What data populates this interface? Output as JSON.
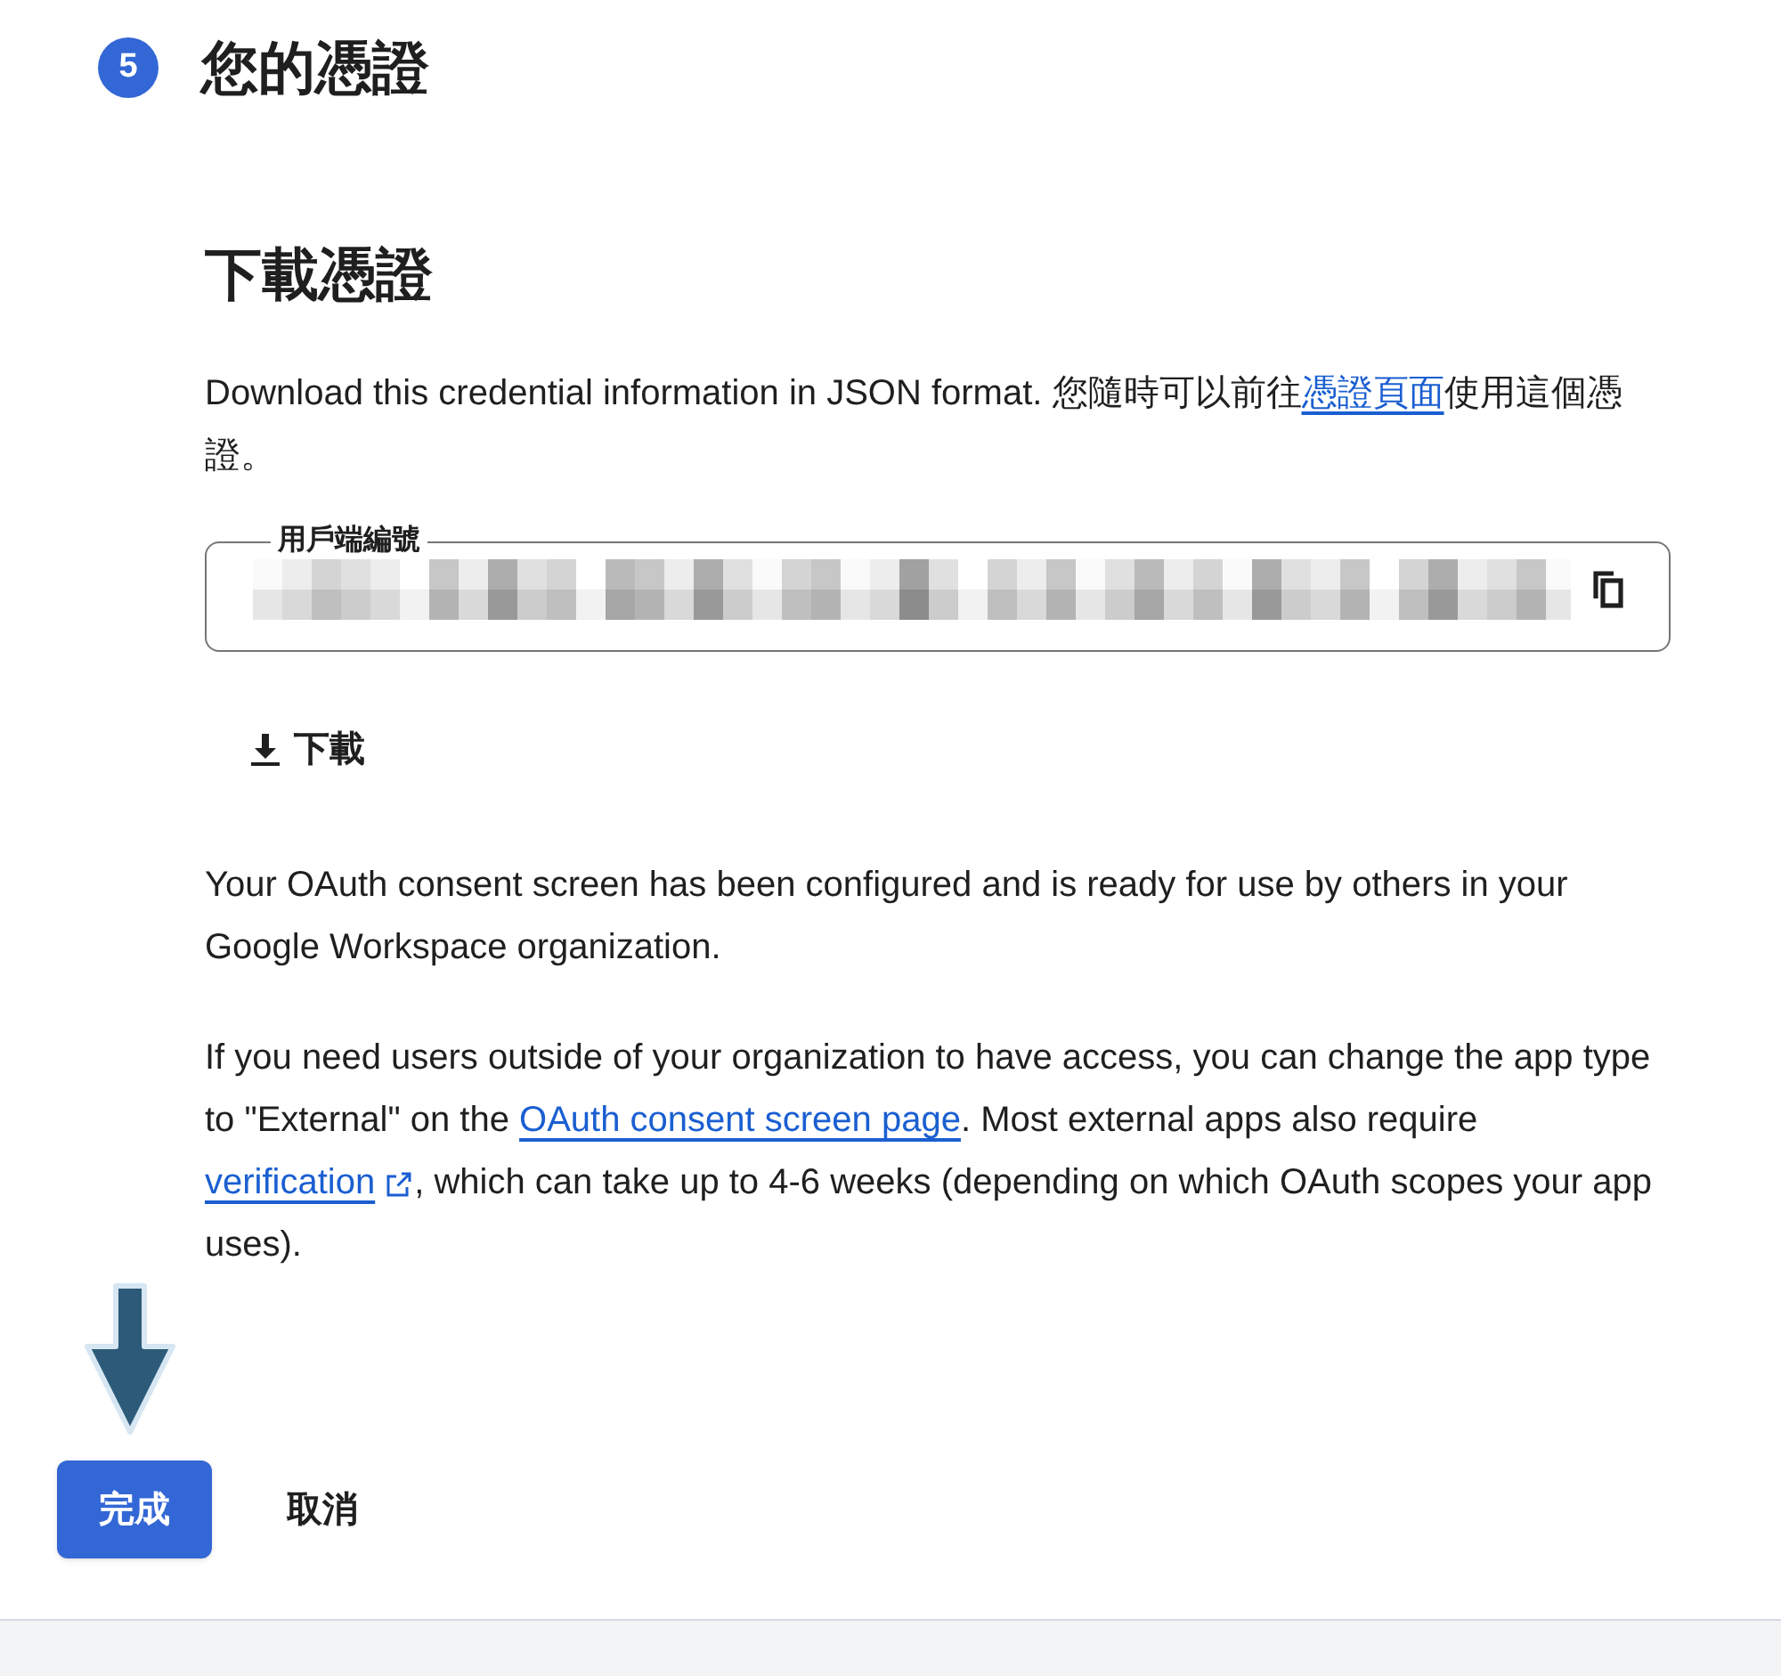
{
  "step": {
    "number": "5",
    "title": "您的憑證"
  },
  "section_title": "下載憑證",
  "intro": [
    {
      "kind": "text",
      "text": "Download this credential information in JSON format. 您隨時可以前往"
    },
    {
      "kind": "link",
      "text": "憑證頁面"
    },
    {
      "kind": "text",
      "text": "使用這個憑證。"
    }
  ],
  "client_id_field": {
    "label": "用戶端編號"
  },
  "download_button": "下載",
  "paragraphs": [
    [
      {
        "kind": "text",
        "text": "Your OAuth consent screen has been configured and is ready for use by others in your Google Workspace organization."
      }
    ],
    [
      {
        "kind": "text",
        "text": "If you need users outside of your organization to have access, you can change the app type to \"External\" on the "
      },
      {
        "kind": "link",
        "text": "OAuth consent screen page"
      },
      {
        "kind": "text",
        "text": ". Most external apps also require "
      },
      {
        "kind": "external_link",
        "text": "verification"
      },
      {
        "kind": "text",
        "text": ", which can take up to 4-6 weeks (depending on which OAuth scopes your app uses)."
      }
    ]
  ],
  "buttons": [
    {
      "kind": "primary",
      "label": "完成"
    },
    {
      "kind": "text",
      "label": "取消"
    }
  ]
}
